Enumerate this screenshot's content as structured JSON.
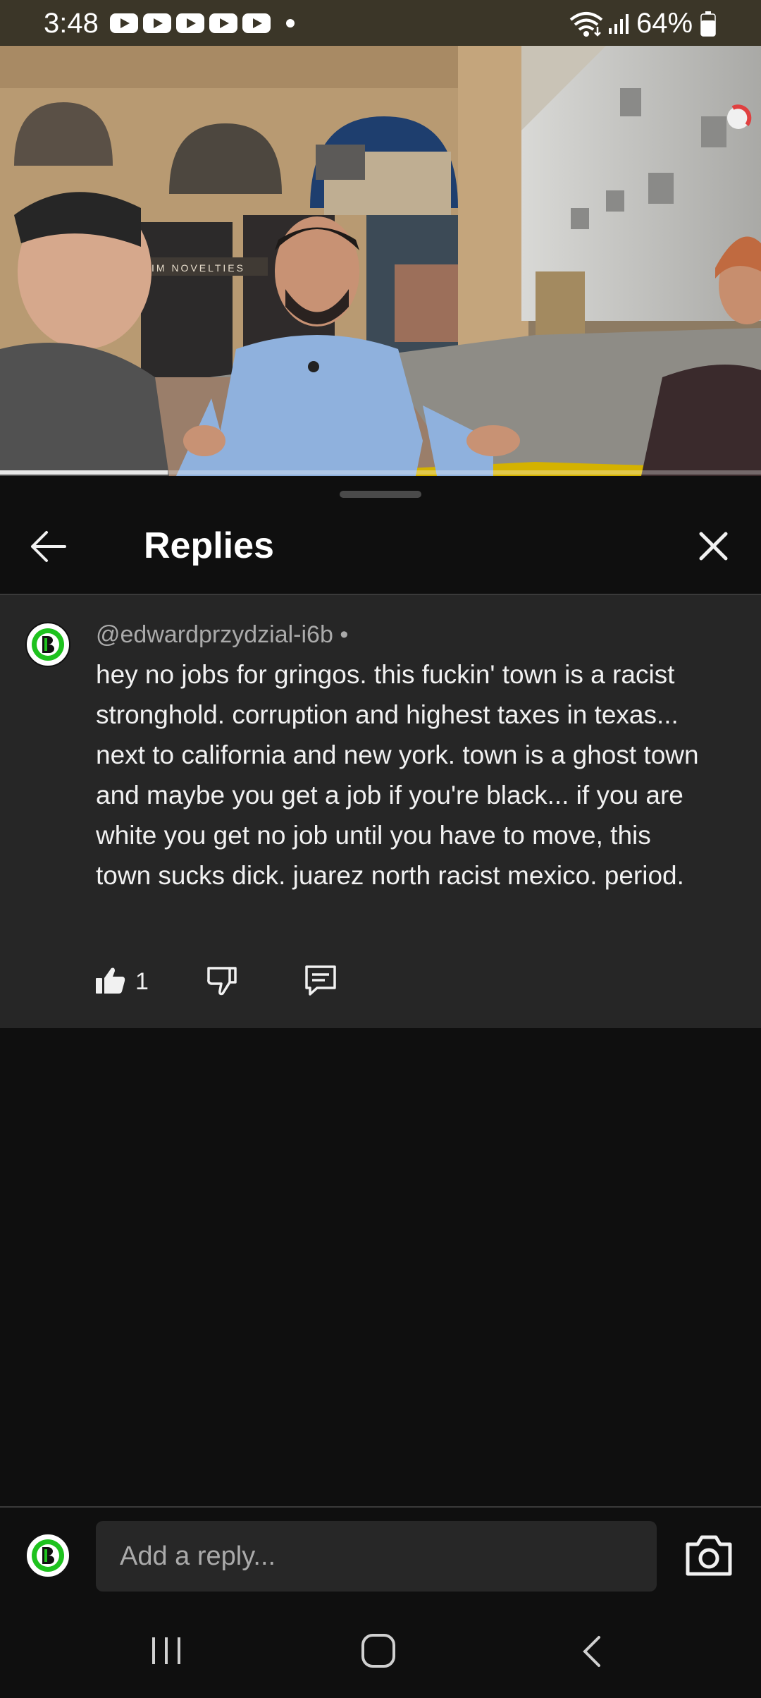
{
  "status_bar": {
    "time": "3:48",
    "battery": "64%",
    "notification_icons": [
      "youtube-icon",
      "youtube-icon",
      "youtube-icon",
      "youtube-icon",
      "youtube-icon"
    ]
  },
  "video": {
    "progress": 0.22,
    "storefront_sign": "IM NOVELTIES"
  },
  "sheet": {
    "title": "Replies"
  },
  "comment": {
    "author": "@edwardprzydzial-i6b •",
    "text": "hey no jobs for gringos. this fuckin' town is a racist stronghold. corruption and highest taxes in texas... next to california and new york. town is a ghost town and maybe you get a job if you're black... if you are white you get no job until you have to move, this town sucks dick. juarez north racist mexico. period.",
    "likes": "1"
  },
  "reply_input": {
    "placeholder": "Add a reply..."
  },
  "colors": {
    "background": "#0f0f0f",
    "comment_bg": "#262626",
    "status_bar": "#3b3628",
    "avatar_green": "#1ec21e"
  }
}
